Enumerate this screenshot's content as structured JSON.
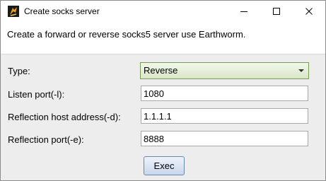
{
  "window": {
    "title": "Create socks server",
    "icon": "earthworm-app-icon"
  },
  "description": "Create a forward or reverse socks5 server use Earthworm.",
  "form": {
    "type": {
      "label": "Type:",
      "value": "Reverse"
    },
    "listen_port": {
      "label": "Listen port(-l):",
      "value": "1080"
    },
    "reflection_host": {
      "label": "Reflection host address(-d):",
      "value": "1.1.1.1"
    },
    "reflection_port": {
      "label": "Reflection port(-e):",
      "value": "8888"
    }
  },
  "exec_label": "Exec"
}
